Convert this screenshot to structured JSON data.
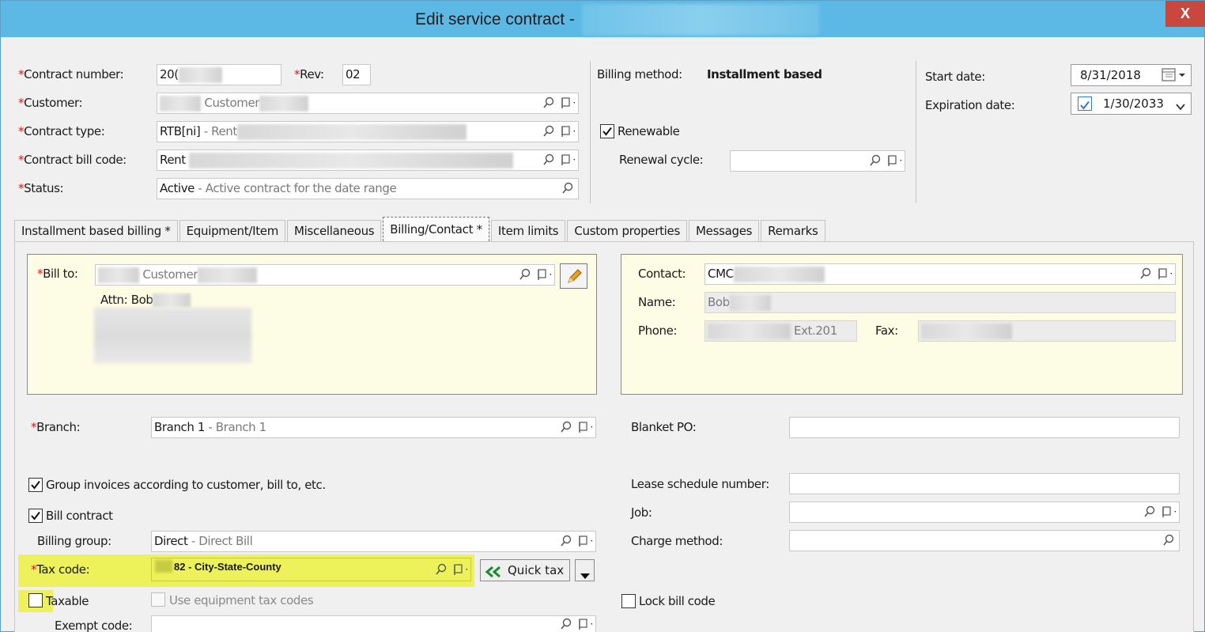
{
  "window": {
    "title": "Edit service contract -",
    "close_label": "X"
  },
  "header": {
    "contract_number_label": "Contract number:",
    "contract_number_value": "20(",
    "rev_label": "Rev:",
    "rev_value": "02",
    "customer_label": "Customer:",
    "customer_value": "Customer",
    "contract_type_label": "Contract type:",
    "contract_type_code": "RTB[ni]",
    "contract_type_desc": " - Rent",
    "contract_bill_code_label": "Contract bill code:",
    "contract_bill_code_value": "Rent",
    "status_label": "Status:",
    "status_code": "Active",
    "status_desc": " - Active contract for the date range",
    "billing_method_label": "Billing method:",
    "billing_method_value": "Installment based",
    "renewable_label": "Renewable",
    "renewal_cycle_label": "Renewal cycle:",
    "start_date_label": "Start date:",
    "start_date_value": "8/31/2018",
    "expiration_date_label": "Expiration date:",
    "expiration_date_value": "1/30/2033"
  },
  "tabs": [
    {
      "label": "Installment based billing *"
    },
    {
      "label": "Equipment/Item"
    },
    {
      "label": "Miscellaneous"
    },
    {
      "label": "Billing/Contact *"
    },
    {
      "label": "Item limits"
    },
    {
      "label": "Custom properties"
    },
    {
      "label": "Messages"
    },
    {
      "label": "Remarks"
    }
  ],
  "billing_contact": {
    "bill_to_label": "Bill to:",
    "bill_to_value": "Customer",
    "attn_label": "Attn: Bob",
    "contact_label": "Contact:",
    "contact_value": "CMC",
    "name_label": "Name:",
    "name_value": "Bob",
    "phone_label": "Phone:",
    "phone_ext": "Ext.201",
    "fax_label": "Fax:",
    "branch_label": "Branch:",
    "branch_code": "Branch 1",
    "branch_desc": " - Branch 1",
    "blanket_po_label": "Blanket PO:",
    "group_invoices_label": "Group invoices according to customer, bill to, etc.",
    "lease_schedule_label": "Lease schedule number:",
    "bill_contract_label": "Bill contract",
    "job_label": "Job:",
    "billing_group_label": "Billing group:",
    "billing_group_code": "Direct",
    "billing_group_desc": " - Direct Bill",
    "charge_method_label": "Charge method:",
    "tax_code_label": "Tax code:",
    "tax_code_value": "82 - City-State-County",
    "quick_tax_label": "Quick tax",
    "taxable_label": "Taxable",
    "use_equipment_tax_label": "Use equipment tax codes",
    "lock_bill_code_label": "Lock bill code",
    "exempt_code_label": "Exempt code:"
  },
  "colors": {
    "titlebar": "#5cb9e6",
    "close": "#c9473c",
    "required": "#d02020",
    "highlight": "#eef25a",
    "panel": "#fdfce4"
  },
  "icons": [
    "search-icon",
    "flag-dropdown-icon",
    "calendar-icon",
    "edit-pencil-icon",
    "quick-tax-chevron-icon",
    "dropdown-arrow-icon"
  ]
}
